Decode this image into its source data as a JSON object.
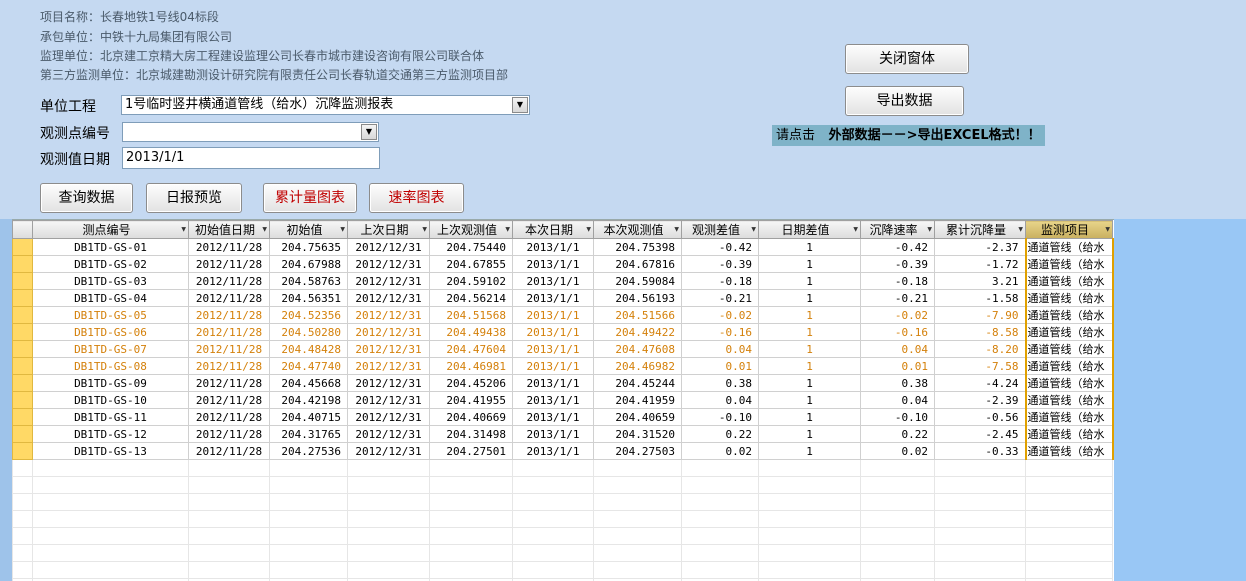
{
  "info": {
    "project": "项目名称：长春地铁1号线04标段",
    "contractor": "承包单位：中铁十九局集团有限公司",
    "supervisor": "监理单位：北京建工京精大房工程建设监理公司长春市城市建设咨询有限公司联合体",
    "third_party": "第三方监测单位：北京城建勘测设计研究院有限责任公司长春轨道交通第三方监测项目部"
  },
  "form": {
    "unit_label": "单位工程",
    "unit_value": "1号临时竖井横通道管线（给水）沉降监测报表",
    "point_label": "观测点编号",
    "point_value": "",
    "date_label": "观测值日期",
    "date_value": "2013/1/1"
  },
  "buttons": {
    "close": "关闭窗体",
    "export": "导出数据",
    "query": "查询数据",
    "daily": "日报预览",
    "cumulative_chart": "累计量图表",
    "rate_chart": "速率图表"
  },
  "hint": {
    "prefix": "请点击",
    "text": "外部数据－－>导出EXCEL格式！！"
  },
  "icons": {
    "dropdown": "▼"
  },
  "grid": {
    "columns": [
      "测点编号",
      "初始值日期",
      "初始值",
      "上次日期",
      "上次观测值",
      "本次日期",
      "本次观测值",
      "观测差值",
      "日期差值",
      "沉降速率",
      "累计沉降量",
      "监测项目"
    ],
    "rows": [
      {
        "hl": false,
        "cells": [
          "DB1TD-GS-01",
          "2012/11/28",
          "204.75635",
          "2012/12/31",
          "204.75440",
          "2013/1/1",
          "204.75398",
          "-0.42",
          "1",
          "-0.42",
          "-2.37",
          "通道管线（给水"
        ]
      },
      {
        "hl": false,
        "cells": [
          "DB1TD-GS-02",
          "2012/11/28",
          "204.67988",
          "2012/12/31",
          "204.67855",
          "2013/1/1",
          "204.67816",
          "-0.39",
          "1",
          "-0.39",
          "-1.72",
          "通道管线（给水"
        ]
      },
      {
        "hl": false,
        "cells": [
          "DB1TD-GS-03",
          "2012/11/28",
          "204.58763",
          "2012/12/31",
          "204.59102",
          "2013/1/1",
          "204.59084",
          "-0.18",
          "1",
          "-0.18",
          "3.21",
          "通道管线（给水"
        ]
      },
      {
        "hl": false,
        "cells": [
          "DB1TD-GS-04",
          "2012/11/28",
          "204.56351",
          "2012/12/31",
          "204.56214",
          "2013/1/1",
          "204.56193",
          "-0.21",
          "1",
          "-0.21",
          "-1.58",
          "通道管线（给水"
        ]
      },
      {
        "hl": true,
        "cells": [
          "DB1TD-GS-05",
          "2012/11/28",
          "204.52356",
          "2012/12/31",
          "204.51568",
          "2013/1/1",
          "204.51566",
          "-0.02",
          "1",
          "-0.02",
          "-7.90",
          "通道管线（给水"
        ]
      },
      {
        "hl": true,
        "cells": [
          "DB1TD-GS-06",
          "2012/11/28",
          "204.50280",
          "2012/12/31",
          "204.49438",
          "2013/1/1",
          "204.49422",
          "-0.16",
          "1",
          "-0.16",
          "-8.58",
          "通道管线（给水"
        ]
      },
      {
        "hl": true,
        "cells": [
          "DB1TD-GS-07",
          "2012/11/28",
          "204.48428",
          "2012/12/31",
          "204.47604",
          "2013/1/1",
          "204.47608",
          "0.04",
          "1",
          "0.04",
          "-8.20",
          "通道管线（给水"
        ]
      },
      {
        "hl": true,
        "cells": [
          "DB1TD-GS-08",
          "2012/11/28",
          "204.47740",
          "2012/12/31",
          "204.46981",
          "2013/1/1",
          "204.46982",
          "0.01",
          "1",
          "0.01",
          "-7.58",
          "通道管线（给水"
        ]
      },
      {
        "hl": false,
        "cells": [
          "DB1TD-GS-09",
          "2012/11/28",
          "204.45668",
          "2012/12/31",
          "204.45206",
          "2013/1/1",
          "204.45244",
          "0.38",
          "1",
          "0.38",
          "-4.24",
          "通道管线（给水"
        ]
      },
      {
        "hl": false,
        "cells": [
          "DB1TD-GS-10",
          "2012/11/28",
          "204.42198",
          "2012/12/31",
          "204.41955",
          "2013/1/1",
          "204.41959",
          "0.04",
          "1",
          "0.04",
          "-2.39",
          "通道管线（给水"
        ]
      },
      {
        "hl": false,
        "cells": [
          "DB1TD-GS-11",
          "2012/11/28",
          "204.40715",
          "2012/12/31",
          "204.40669",
          "2013/1/1",
          "204.40659",
          "-0.10",
          "1",
          "-0.10",
          "-0.56",
          "通道管线（给水"
        ]
      },
      {
        "hl": false,
        "cells": [
          "DB1TD-GS-12",
          "2012/11/28",
          "204.31765",
          "2012/12/31",
          "204.31498",
          "2013/1/1",
          "204.31520",
          "0.22",
          "1",
          "0.22",
          "-2.45",
          "通道管线（给水"
        ]
      },
      {
        "hl": false,
        "cells": [
          "DB1TD-GS-13",
          "2012/11/28",
          "204.27536",
          "2012/12/31",
          "204.27501",
          "2013/1/1",
          "204.27503",
          "0.02",
          "1",
          "0.02",
          "-0.33",
          "通道管线（给水"
        ]
      }
    ]
  }
}
